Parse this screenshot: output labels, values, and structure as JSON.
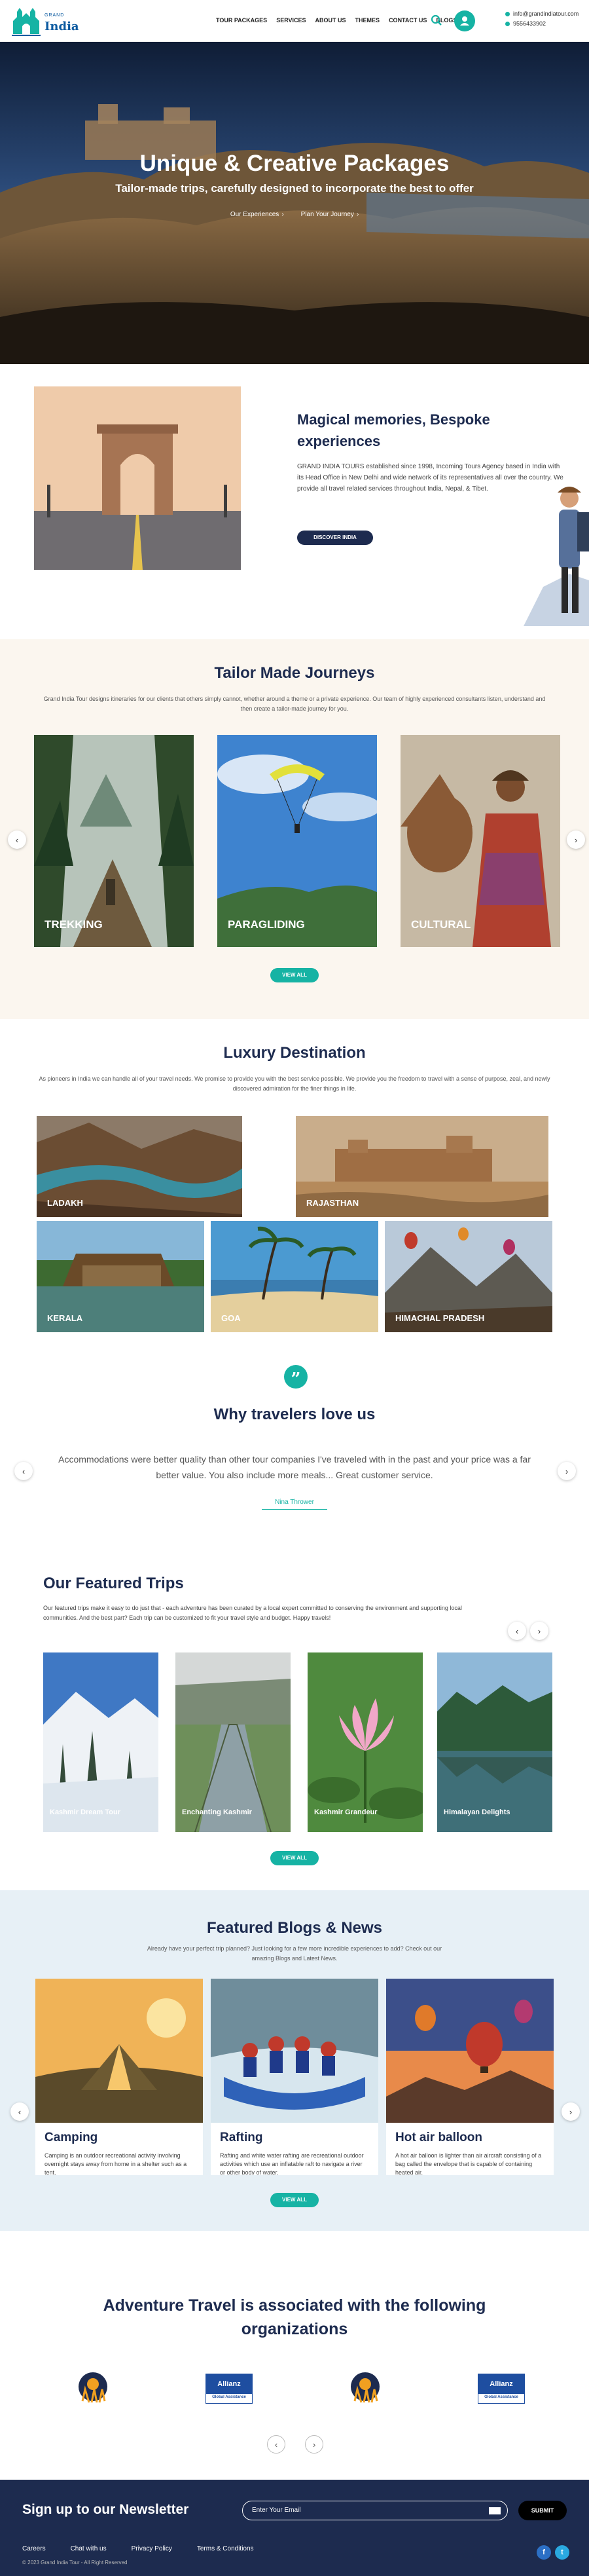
{
  "header": {
    "logo_top": "GRAND",
    "logo_text": "India",
    "nav": [
      "TOUR PACKAGES",
      "SERVICES",
      "ABOUT US",
      "THEMES",
      "CONTACT US",
      "BLOGS"
    ],
    "email": "info@grandindiatour.com",
    "phone": "9556433902"
  },
  "hero": {
    "title": "Unique & Creative Packages",
    "subtitle": "Tailor-made trips, carefully designed to incorporate the best to offer",
    "link1": "Our Experiences",
    "link2": "Plan Your Journey"
  },
  "magical": {
    "title": "Magical memories, Bespoke experiences",
    "text": "GRAND INDIA TOURS established since 1998, Incoming Tours Agency based in India with its Head Office in New Delhi and wide network of its representatives all over the country. We provide all travel related services throughout India, Nepal, & Tibet.",
    "button": "DISCOVER INDIA"
  },
  "tailor": {
    "title": "Tailor Made Journeys",
    "desc": "Grand India Tour designs itineraries for our clients that others simply cannot, whether around a theme or a private experience. Our team of highly experienced consultants listen, understand and then create a tailor-made journey for you.",
    "cards": [
      "TREKKING",
      "PARAGLIDING",
      "CULTURAL"
    ],
    "button": "VIEW ALL"
  },
  "luxury": {
    "title": "Luxury Destination",
    "desc": "As pioneers in India we can handle all of your travel needs. We promise to provide you with the best service possible. We provide you the freedom to travel with a sense of purpose, zeal, and newly discovered admiration for the finer things in life.",
    "cards": [
      "LADAKH",
      "RAJASTHAN",
      "KERALA",
      "GOA",
      "HIMACHAL PRADESH"
    ]
  },
  "why": {
    "title": "Why travelers love us",
    "review": "Accommodations were better quality than other tour companies I've traveled with in the past and your price was a far better value. You also include more meals... Great customer service.",
    "reviewer": "Nina Thrower"
  },
  "trips": {
    "title": "Our Featured Trips",
    "desc": "Our featured trips make it easy to do just that - each adventure has been curated by a local expert committed to conserving the environment and supporting local communities. And the best part? Each trip can be customized to fit your travel style and budget. Happy travels!",
    "cards": [
      "Kashmir Dream Tour",
      "Enchanting Kashmir",
      "Kashmir Grandeur",
      "Himalayan Delights"
    ],
    "button": "VIEW ALL"
  },
  "blogs": {
    "title": "Featured Blogs & News",
    "desc": "Already have your perfect trip planned? Just looking for a few more incredible experiences to add? Check out our amazing Blogs and Latest News.",
    "cards": [
      {
        "title": "Camping",
        "text": "Camping is an outdoor recreational activity involving overnight stays away from home in a shelter such as a tent."
      },
      {
        "title": "Rafting",
        "text": "Rafting and white water rafting are recreational outdoor activities which use an inflatable raft to navigate a river or other body of water."
      },
      {
        "title": "Hot air balloon",
        "text": "A hot air balloon is lighter than air aircraft consisting of a bag called the envelope that is capable of containing heated air."
      }
    ],
    "button": "VIEW ALL"
  },
  "orgs": {
    "title": "Adventure Travel is associated with the following organizations",
    "allianz": "Allianz",
    "allianz_sub": "Global Assistance"
  },
  "footer": {
    "newsletter": "Sign up to our Newsletter",
    "email_placeholder": "Enter Your Email",
    "submit": "SUBMIT",
    "links": [
      "Careers",
      "Chat with us",
      "Privacy Policy",
      "Terms & Conditions"
    ],
    "copyright": "© 2023 Grand India Tour - All Right Reserved",
    "social": [
      "f",
      "t"
    ]
  }
}
